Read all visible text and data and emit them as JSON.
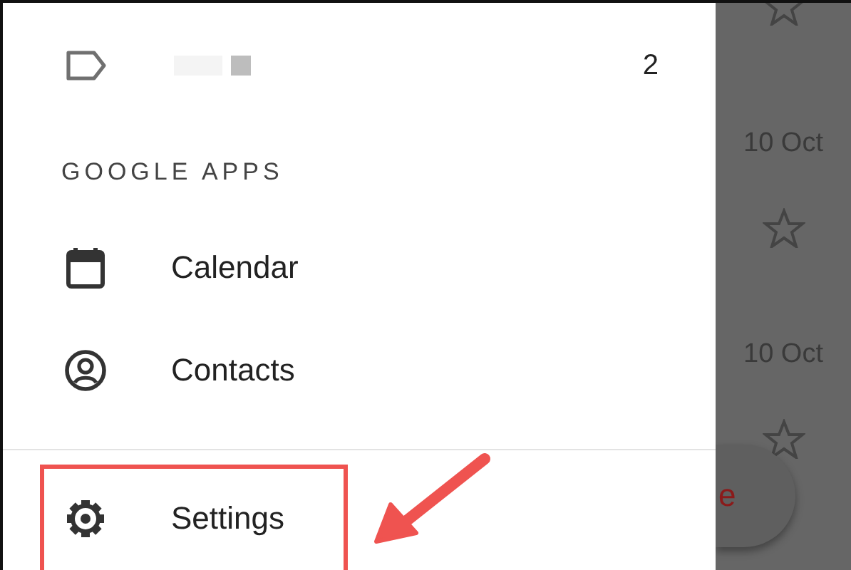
{
  "drawer": {
    "label_item": {
      "count": "2"
    },
    "section_header": "GOOGLE APPS",
    "apps": [
      {
        "kind": "calendar",
        "label": "Calendar"
      },
      {
        "kind": "contacts",
        "label": "Contacts"
      }
    ],
    "settings": {
      "label": "Settings",
      "highlighted": true
    }
  },
  "background_list": {
    "dates": [
      "10 Oct",
      "10 Oct"
    ],
    "fab_text": "e"
  },
  "annotation": {
    "arrow": true
  }
}
